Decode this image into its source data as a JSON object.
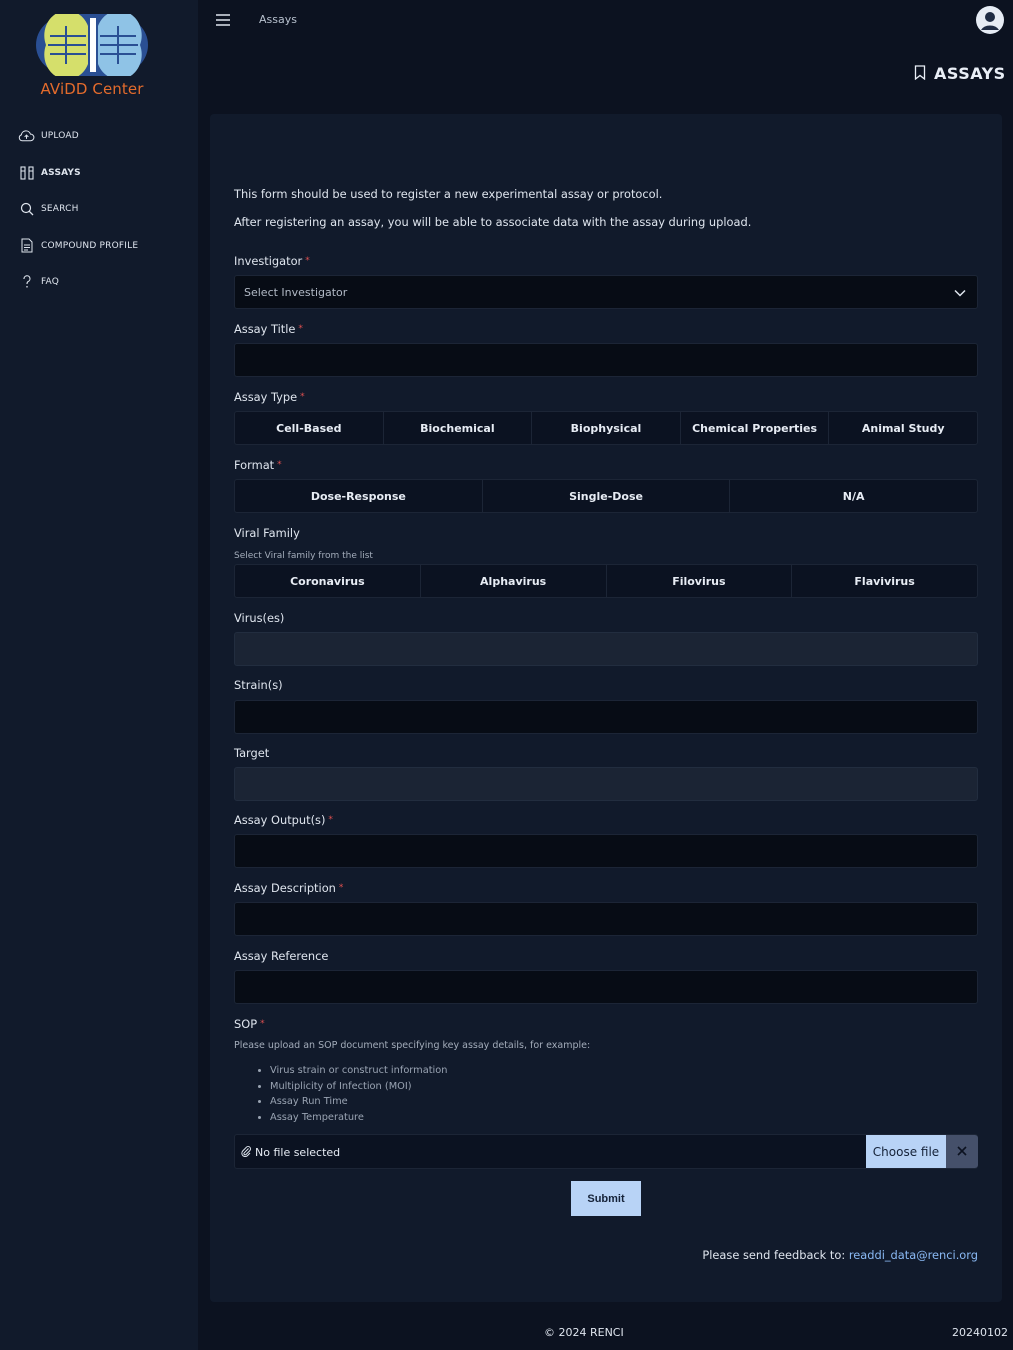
{
  "brand": {
    "name": "AViDD Center"
  },
  "nav": {
    "items": [
      {
        "label": "UPLOAD",
        "icon": "cloud-upload-icon",
        "active": false
      },
      {
        "label": "ASSAYS",
        "icon": "columns-icon",
        "active": true
      },
      {
        "label": "SEARCH",
        "icon": "search-icon",
        "active": false
      },
      {
        "label": "COMPOUND PROFILE",
        "icon": "document-icon",
        "active": false
      },
      {
        "label": "FAQ",
        "icon": "question-icon",
        "active": false
      }
    ]
  },
  "topbar": {
    "breadcrumb": "Assays"
  },
  "header": {
    "title": "ASSAYS",
    "icon": "bookmark-icon"
  },
  "form": {
    "intro1": "This form should be used to register a new experimental assay or protocol.",
    "intro2": "After registering an assay, you will be able to associate data with the assay during upload.",
    "investigator": {
      "label": "Investigator",
      "required": "*",
      "placeholder": "Select Investigator"
    },
    "assay_title": {
      "label": "Assay Title",
      "required": "*",
      "value": ""
    },
    "assay_type": {
      "label": "Assay Type",
      "required": "*",
      "options": [
        "Cell-Based",
        "Biochemical",
        "Biophysical",
        "Chemical Properties",
        "Animal Study"
      ]
    },
    "format": {
      "label": "Format",
      "required": "*",
      "options": [
        "Dose-Response",
        "Single-Dose",
        "N/A"
      ]
    },
    "viral_family": {
      "label": "Viral Family",
      "hint": "Select Viral family from the list",
      "options": [
        "Coronavirus",
        "Alphavirus",
        "Filovirus",
        "Flavivirus"
      ]
    },
    "viruses": {
      "label": "Virus(es)",
      "value": ""
    },
    "strains": {
      "label": "Strain(s)",
      "value": ""
    },
    "target": {
      "label": "Target",
      "value": ""
    },
    "assay_outputs": {
      "label": "Assay Output(s)",
      "required": "*",
      "value": ""
    },
    "assay_description": {
      "label": "Assay Description",
      "required": "*",
      "value": ""
    },
    "assay_reference": {
      "label": "Assay Reference",
      "value": ""
    },
    "sop": {
      "label": "SOP",
      "required": "*",
      "hint": "Please upload an SOP document specifying key assay details, for example:",
      "items": [
        "Virus strain or construct information",
        "Multiplicity of Infection (MOI)",
        "Assay Run Time",
        "Assay Temperature"
      ],
      "file_status": "No file selected",
      "choose_label": "Choose file"
    },
    "submit_label": "Submit",
    "feedback_text": "Please send feedback to:",
    "feedback_email": "readdi_data@renci.org"
  },
  "footer": {
    "copyright": "© 2024 RENCI",
    "version": "20240102"
  },
  "colors": {
    "accent": "#b8d3f6",
    "brand_orange": "#e36b2c",
    "background": "#0c1220",
    "panel": "#111a2b"
  }
}
